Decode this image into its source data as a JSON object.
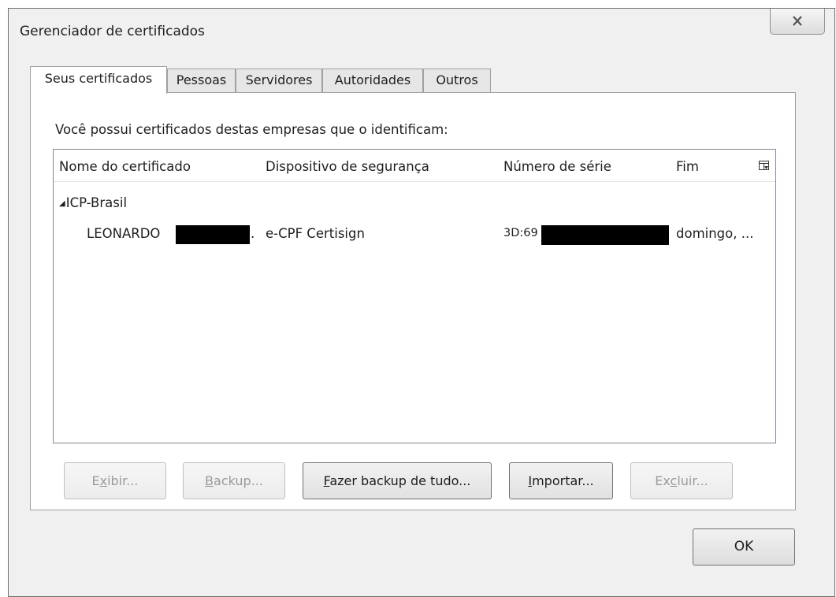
{
  "window": {
    "title": "Gerenciador de certificados"
  },
  "tabs": [
    {
      "label": "Seus certificados",
      "active": true
    },
    {
      "label": "Pessoas",
      "active": false
    },
    {
      "label": "Servidores",
      "active": false
    },
    {
      "label": "Autoridades",
      "active": false
    },
    {
      "label": "Outros",
      "active": false
    }
  ],
  "panel": {
    "intro": "Você possui certificados destas empresas que o identificam:"
  },
  "tree": {
    "columns": [
      "Nome do certificado",
      "Dispositivo de segurança",
      "Número de série",
      "Fim"
    ],
    "groups": [
      {
        "name": "ICP-Brasil",
        "rows": [
          {
            "name": "LEONARDO",
            "name_suffix": ".",
            "device": "e-CPF Certisign",
            "serial": "3D:69",
            "end": "domingo, ..."
          }
        ]
      }
    ]
  },
  "buttons": {
    "view_pre": "E",
    "view_key": "x",
    "view_post": "ibir...",
    "backup_key": "B",
    "backup_post": "ackup...",
    "backup_all_key": "F",
    "backup_all_post": "azer backup de tudo...",
    "import_key": "I",
    "import_post": "mportar...",
    "delete_pre": "Ex",
    "delete_key": "c",
    "delete_post": "luir...",
    "ok": "OK"
  },
  "icons": {
    "close": "close-icon",
    "column_picker": "column-picker-icon"
  }
}
